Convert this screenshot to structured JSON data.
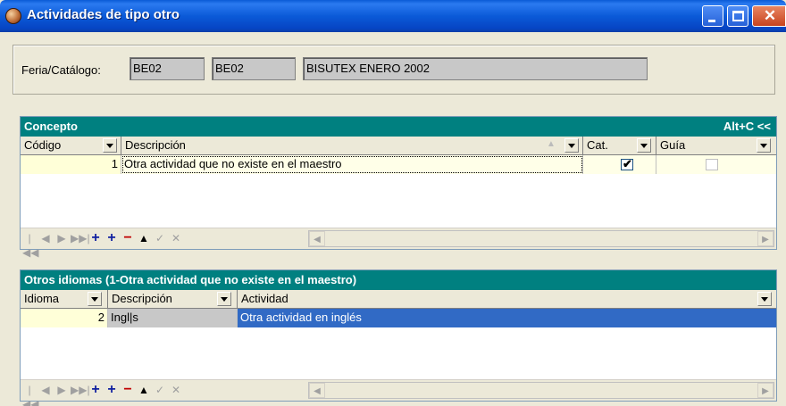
{
  "window": {
    "title": "Actividades de tipo otro"
  },
  "feria": {
    "label": "Feria/Catálogo:",
    "field1": "BE02",
    "field2": "BE02",
    "field3": "BISUTEX ENERO 2002"
  },
  "concepto": {
    "title": "Concepto",
    "shortcut": "Alt+C <<",
    "columns": {
      "codigo": "Código",
      "descripcion": "Descripción",
      "cat": "Cat.",
      "guia": "Guía"
    },
    "rows": [
      {
        "codigo": "1",
        "descripcion": "Otra actividad que no existe en el maestro",
        "cat": true,
        "guia": false
      }
    ]
  },
  "idiomas": {
    "title": "Otros idiomas (1-Otra actividad que no existe en el maestro)",
    "columns": {
      "idioma": "Idioma",
      "descripcion": "Descripción",
      "actividad": "Actividad"
    },
    "rows": [
      {
        "idioma": "2",
        "descripcion": "Ingl|s",
        "actividad": "Otra actividad en inglés"
      }
    ]
  },
  "navigator": {
    "first": "|◀◀",
    "prior": "◀",
    "next": "▶",
    "last": "▶▶|",
    "insert": "+",
    "append": "+",
    "delete": "−",
    "edit": "▲",
    "post": "✓",
    "cancel": "✕"
  },
  "scroll": {
    "left": "◀",
    "right": "▶"
  },
  "colors": {
    "titlebar": "#0a5bd6",
    "panel_header": "#008080",
    "selection": "#316ac5"
  }
}
